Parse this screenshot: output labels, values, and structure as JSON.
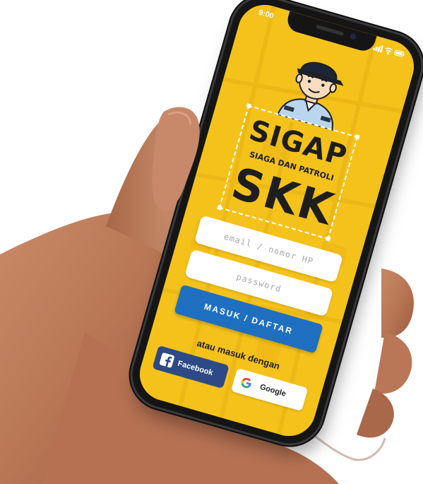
{
  "status_bar": {
    "time": "9:00",
    "icons": [
      "signal-icon",
      "wifi-icon",
      "battery-icon"
    ]
  },
  "logo": {
    "title": "SIGAP",
    "subtitle": "SIAGA DAN PATROLI",
    "name": "SKK"
  },
  "login_form": {
    "email_placeholder": "email / nomor HP",
    "password_placeholder": "password",
    "submit_label": "MASUK / DAFTAR"
  },
  "social_login": {
    "label": "atau masuk dengan",
    "facebook_label": "Facebook",
    "google_label": "Google"
  },
  "colors": {
    "screen_background": "#f5c21b",
    "primary_button": "#1f6fc0",
    "facebook_button": "#2d4a86",
    "text_dark": "#1e1e1e"
  }
}
